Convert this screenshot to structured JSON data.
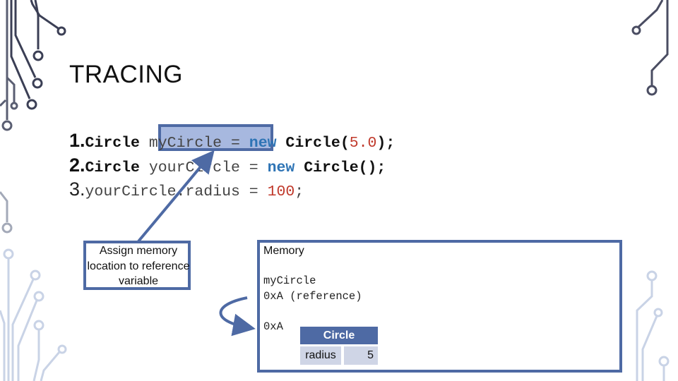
{
  "slide": {
    "title": "TRACING",
    "accent_color": "#4e6aa4"
  },
  "code": {
    "lines": [
      {
        "num": "1.",
        "parts": [
          {
            "t": "Circle ",
            "c": "b"
          },
          {
            "t": "myCircle = ",
            "c": "l"
          },
          {
            "t": "new",
            "c": "kw"
          },
          {
            "t": " Circle(",
            "c": "b"
          },
          {
            "t": "5.0",
            "c": "lit"
          },
          {
            "t": ");",
            "c": "b"
          }
        ]
      },
      {
        "num": "2.",
        "parts": [
          {
            "t": "Circle ",
            "c": "b"
          },
          {
            "t": "yourCircle = ",
            "c": "l"
          },
          {
            "t": "new",
            "c": "kw"
          },
          {
            "t": " Circle();",
            "c": "b"
          }
        ]
      },
      {
        "num": "3.",
        "parts": [
          {
            "t": "yourCircle.radius = ",
            "c": "l"
          },
          {
            "t": "100",
            "c": "lit"
          },
          {
            "t": ";",
            "c": "l"
          }
        ]
      }
    ],
    "highlighted_segment": "myCircle ="
  },
  "callout": {
    "text": "Assign memory location to reference variable"
  },
  "memory": {
    "label": "Memory",
    "variable_name": "myCircle",
    "variable_value": "0xA (reference)",
    "address": "0xA",
    "object": {
      "class_name": "Circle",
      "fields": [
        {
          "name": "radius",
          "value": "5"
        }
      ]
    }
  }
}
